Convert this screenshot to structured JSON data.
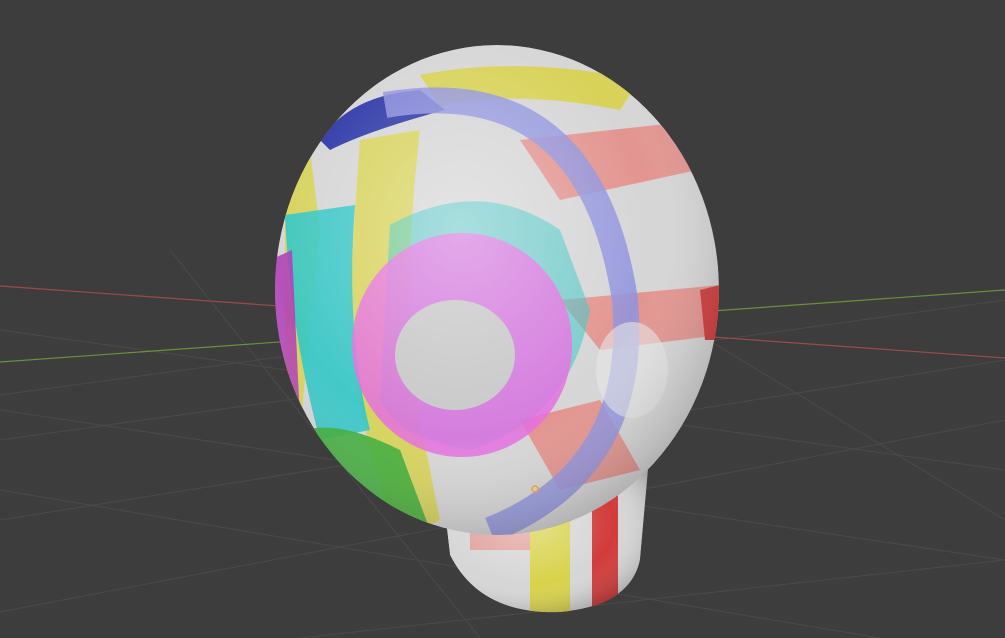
{
  "viewport": {
    "background_color": "#3d3d3d",
    "grid_color": "#4a4a4a",
    "x_axis_color": "#9a4b4b",
    "y_axis_color": "#6c8f3a",
    "object_origin_color": "#f0a030"
  },
  "model": {
    "base_color": "#d6d6d6",
    "face_groups": [
      {
        "name": "blue-cap",
        "color": "#2f3aa8"
      },
      {
        "name": "yellow-band",
        "color": "#d8d24a"
      },
      {
        "name": "cyan-band",
        "color": "#33c6c6"
      },
      {
        "name": "magenta-ring",
        "color": "#e56ee0"
      },
      {
        "name": "lavender-ring",
        "color": "#8f93de"
      },
      {
        "name": "salmon-band",
        "color": "#e58a84"
      },
      {
        "name": "red-band",
        "color": "#d23a3a"
      },
      {
        "name": "green-patch",
        "color": "#3fae3a"
      },
      {
        "name": "purple-edge",
        "color": "#b03ab8"
      }
    ]
  }
}
